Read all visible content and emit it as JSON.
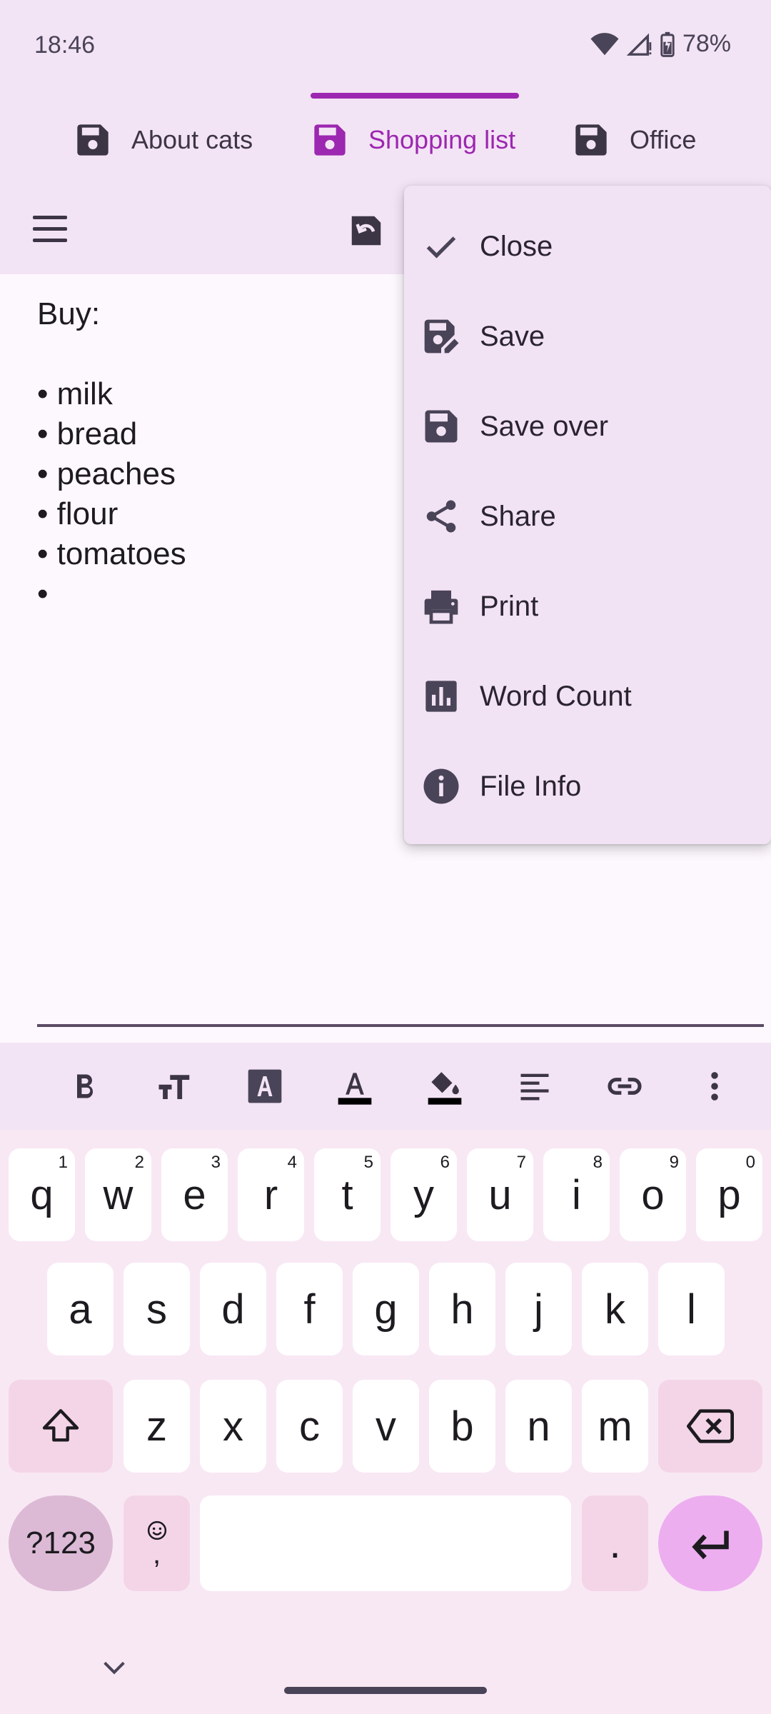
{
  "status_bar": {
    "time": "18:46",
    "battery": "78%"
  },
  "tabs": [
    {
      "label": "About cats",
      "active": false
    },
    {
      "label": "Shopping list",
      "active": true
    },
    {
      "label": "Office",
      "active": false
    }
  ],
  "editor": {
    "content": "Buy:\n\n• milk\n• bread\n• peaches\n• flour\n• tomatoes\n• "
  },
  "menu": {
    "items": [
      {
        "label": "Close",
        "icon": "check-icon"
      },
      {
        "label": "Save",
        "icon": "save-edit-icon"
      },
      {
        "label": "Save over",
        "icon": "save-icon"
      },
      {
        "label": "Share",
        "icon": "share-icon"
      },
      {
        "label": "Print",
        "icon": "print-icon"
      },
      {
        "label": "Word Count",
        "icon": "bar-chart-icon"
      },
      {
        "label": "File Info",
        "icon": "info-icon"
      }
    ]
  },
  "format_toolbar": [
    "bold-icon",
    "text-size-icon",
    "text-style-icon",
    "text-color-icon",
    "highlight-icon",
    "align-icon",
    "link-icon",
    "more-vert-icon"
  ],
  "keyboard": {
    "row1": [
      {
        "key": "q",
        "hint": "1"
      },
      {
        "key": "w",
        "hint": "2"
      },
      {
        "key": "e",
        "hint": "3"
      },
      {
        "key": "r",
        "hint": "4"
      },
      {
        "key": "t",
        "hint": "5"
      },
      {
        "key": "y",
        "hint": "6"
      },
      {
        "key": "u",
        "hint": "7"
      },
      {
        "key": "i",
        "hint": "8"
      },
      {
        "key": "o",
        "hint": "9"
      },
      {
        "key": "p",
        "hint": "0"
      }
    ],
    "row2": [
      "a",
      "s",
      "d",
      "f",
      "g",
      "h",
      "j",
      "k",
      "l"
    ],
    "row3": [
      "z",
      "x",
      "c",
      "v",
      "b",
      "n",
      "m"
    ],
    "symbols_label": "?123",
    "comma_label": ",",
    "period_label": "."
  },
  "colors": {
    "accent": "#9c27b0",
    "background": "#f3e4f5",
    "editor_bg": "#fdf8fe"
  }
}
